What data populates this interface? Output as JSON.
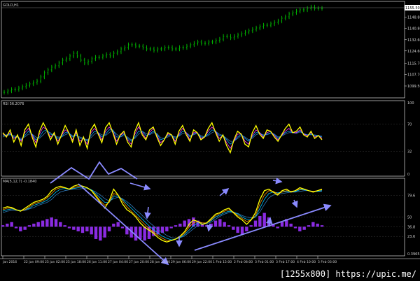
{
  "chart_data": [
    {
      "type": "ohlc",
      "symbol_label": "GOLD,H1",
      "price_axis": {
        "ylim": [
          1093,
          1158
        ],
        "ticks": [
          1148.8,
          1140.8,
          1132.6,
          1124.6,
          1115.7,
          1107.7,
          1099.5
        ],
        "current_price": 1155.5,
        "current_price_label": "1155.50"
      },
      "close_series": [
        1095,
        1096,
        1097,
        1097,
        1098,
        1099,
        1100,
        1101,
        1102,
        1103,
        1106,
        1109,
        1111,
        1113,
        1114,
        1116,
        1118,
        1119,
        1121,
        1123,
        1121,
        1118,
        1116,
        1117,
        1119,
        1120,
        1120,
        1121,
        1122,
        1121,
        1123,
        1124,
        1126,
        1127,
        1129,
        1129,
        1128,
        1128,
        1127,
        1126,
        1126,
        1125,
        1126,
        1126,
        1127,
        1127,
        1126,
        1126,
        1127,
        1127,
        1128,
        1129,
        1130,
        1131,
        1130,
        1130,
        1131,
        1131,
        1132,
        1133,
        1135,
        1135,
        1134,
        1135,
        1136,
        1137,
        1138,
        1139,
        1140,
        1141,
        1142,
        1143,
        1143,
        1144,
        1145,
        1146,
        1148,
        1149,
        1151,
        1152,
        1153,
        1154,
        1154,
        1155,
        1156,
        1155,
        1155,
        1155
      ]
    },
    {
      "type": "line",
      "title": "RSI 56.2076",
      "ylim": [
        0,
        100
      ],
      "tick_labels": [
        "100",
        "70",
        "32",
        "0"
      ],
      "tick_values": [
        100,
        70,
        32,
        0
      ],
      "series": [
        {
          "color": "#ffff00",
          "values": [
            58,
            52,
            62,
            45,
            55,
            40,
            62,
            70,
            52,
            38,
            60,
            72,
            62,
            48,
            58,
            42,
            55,
            68,
            58,
            45,
            62,
            40,
            52,
            36,
            62,
            70,
            56,
            44,
            65,
            72,
            58,
            42,
            55,
            60,
            45,
            38,
            60,
            72,
            55,
            48,
            62,
            66,
            52,
            40,
            48,
            58,
            55,
            42,
            60,
            68,
            55,
            46,
            62,
            58,
            48,
            52,
            64,
            72,
            58,
            46,
            55,
            40,
            30,
            48,
            60,
            56,
            42,
            38,
            58,
            68,
            56,
            50,
            62,
            60,
            52,
            46,
            55,
            64,
            70,
            58,
            60,
            66,
            55,
            52,
            60,
            50,
            54,
            48
          ]
        },
        {
          "color": "#ff33ff",
          "values": [
            56,
            54,
            58,
            50,
            53,
            46,
            58,
            64,
            55,
            44,
            56,
            66,
            62,
            52,
            56,
            46,
            54,
            62,
            58,
            48,
            58,
            46,
            50,
            42,
            58,
            64,
            58,
            48,
            60,
            66,
            60,
            46,
            54,
            58,
            48,
            42,
            56,
            66,
            58,
            50,
            58,
            64,
            54,
            44,
            48,
            56,
            55,
            46,
            56,
            64,
            58,
            48,
            58,
            58,
            50,
            52,
            60,
            66,
            60,
            50,
            54,
            44,
            36,
            46,
            56,
            56,
            46,
            42,
            54,
            62,
            58,
            52,
            58,
            60,
            54,
            48,
            54,
            60,
            64,
            58,
            58,
            62,
            56,
            54,
            58,
            52,
            54,
            50
          ]
        },
        {
          "color": "#00a0ff",
          "values": [
            54,
            55,
            56,
            52,
            52,
            48,
            54,
            60,
            56,
            48,
            52,
            60,
            62,
            56,
            54,
            50,
            52,
            58,
            58,
            52,
            55,
            50,
            50,
            46,
            54,
            60,
            58,
            52,
            56,
            62,
            62,
            52,
            52,
            56,
            50,
            46,
            52,
            60,
            60,
            54,
            56,
            60,
            56,
            48,
            50,
            54,
            55,
            50,
            54,
            60,
            58,
            52,
            56,
            58,
            52,
            52,
            56,
            62,
            60,
            54,
            54,
            48,
            42,
            46,
            52,
            56,
            50,
            46,
            52,
            58,
            58,
            54,
            56,
            58,
            56,
            50,
            54,
            58,
            60,
            58,
            58,
            60,
            56,
            55,
            56,
            54,
            54,
            52
          ]
        },
        {
          "color": "#3a6fa0",
          "values": [
            52,
            54,
            55,
            54,
            52,
            50,
            52,
            56,
            56,
            52,
            50,
            55,
            60,
            58,
            54,
            52,
            52,
            55,
            57,
            54,
            54,
            52,
            50,
            48,
            51,
            56,
            58,
            55,
            54,
            58,
            61,
            56,
            52,
            54,
            52,
            48,
            50,
            56,
            60,
            57,
            55,
            58,
            57,
            51,
            50,
            52,
            54,
            52,
            53,
            57,
            58,
            54,
            55,
            57,
            54,
            52,
            54,
            58,
            60,
            56,
            54,
            50,
            46,
            46,
            50,
            54,
            52,
            48,
            50,
            55,
            57,
            55,
            55,
            57,
            56,
            52,
            53,
            56,
            58,
            58,
            57,
            59,
            57,
            55,
            55,
            55,
            54,
            53
          ]
        }
      ]
    },
    {
      "type": "line+bar",
      "title": "MA(5,12,7) -0.1840",
      "ylim": [
        0,
        100
      ],
      "tick_labels": [
        "79.6",
        "50",
        "36.8",
        "23.6",
        "0.3965"
      ],
      "tick_values": [
        79.6,
        50,
        36.8,
        23.6,
        0
      ],
      "lines": [
        {
          "color": "#ffff00",
          "values": [
            62,
            64,
            63,
            60,
            58,
            62,
            66,
            70,
            72,
            74,
            78,
            86,
            90,
            92,
            90,
            88,
            92,
            94,
            92,
            90,
            86,
            78,
            70,
            62,
            72,
            88,
            80,
            68,
            60,
            56,
            50,
            42,
            36,
            32,
            28,
            22,
            18,
            16,
            18,
            20,
            24,
            30,
            40,
            46,
            44,
            40,
            42,
            48,
            54,
            56,
            60,
            62,
            56,
            50,
            46,
            40,
            46,
            56,
            74,
            86,
            88,
            84,
            80,
            86,
            88,
            84,
            86,
            90,
            88,
            86,
            84,
            86,
            88
          ]
        },
        {
          "color": "#ff9900",
          "values": [
            60,
            62,
            62,
            60,
            58,
            60,
            64,
            68,
            70,
            72,
            76,
            82,
            88,
            90,
            90,
            88,
            90,
            92,
            92,
            90,
            86,
            80,
            72,
            66,
            70,
            82,
            80,
            72,
            64,
            58,
            52,
            46,
            40,
            34,
            30,
            25,
            21,
            18,
            18,
            20,
            23,
            28,
            36,
            42,
            44,
            42,
            42,
            46,
            52,
            55,
            58,
            60,
            57,
            52,
            48,
            44,
            46,
            52,
            68,
            80,
            86,
            85,
            82,
            84,
            86,
            85,
            86,
            88,
            88,
            86,
            85,
            86,
            87
          ]
        },
        {
          "color": "#00c8ff",
          "values": [
            58,
            60,
            61,
            60,
            59,
            60,
            62,
            66,
            68,
            70,
            73,
            78,
            84,
            88,
            89,
            88,
            89,
            90,
            91,
            90,
            87,
            82,
            76,
            70,
            70,
            78,
            79,
            74,
            68,
            62,
            56,
            50,
            44,
            38,
            33,
            28,
            24,
            21,
            19,
            20,
            22,
            26,
            32,
            38,
            42,
            42,
            42,
            45,
            50,
            53,
            56,
            58,
            57,
            54,
            50,
            47,
            47,
            50,
            62,
            74,
            82,
            84,
            83,
            84,
            85,
            85,
            85,
            87,
            87,
            86,
            85,
            85,
            86
          ]
        },
        {
          "color": "#2f78b8",
          "values": [
            56,
            58,
            59,
            59,
            59,
            59,
            61,
            63,
            66,
            68,
            70,
            74,
            80,
            84,
            86,
            87,
            88,
            88,
            89,
            89,
            87,
            84,
            80,
            75,
            72,
            75,
            77,
            75,
            71,
            66,
            60,
            55,
            49,
            43,
            38,
            33,
            29,
            25,
            22,
            21,
            22,
            24,
            29,
            34,
            38,
            40,
            41,
            43,
            47,
            51,
            54,
            56,
            56,
            55,
            52,
            50,
            49,
            50,
            57,
            67,
            76,
            80,
            81,
            82,
            83,
            84,
            84,
            85,
            86,
            86,
            85,
            85,
            85
          ]
        }
      ],
      "histogram": [
        0.1,
        0.2,
        0.3,
        -0.1,
        -0.3,
        -0.2,
        0.1,
        0.2,
        0.3,
        0.4,
        0.5,
        0.6,
        0.5,
        0.3,
        0.1,
        -0.1,
        -0.2,
        -0.3,
        -0.4,
        -0.3,
        -0.5,
        -0.8,
        -0.9,
        -0.7,
        -0.3,
        0.2,
        0.3,
        -0.1,
        -0.5,
        -0.7,
        -0.9,
        -0.8,
        -0.9,
        -0.8,
        -0.6,
        -0.5,
        -0.4,
        -0.3,
        -0.1,
        0.1,
        0.2,
        0.4,
        0.5,
        0.6,
        0.4,
        0.2,
        0.1,
        0.2,
        0.4,
        0.5,
        0.3,
        0.1,
        -0.2,
        -0.4,
        -0.5,
        -0.3,
        0.1,
        0.4,
        0.7,
        0.9,
        0.6,
        0.2,
        -0.1,
        0.3,
        0.5,
        0.2,
        -0.1,
        -0.3,
        -0.2,
        0.1,
        0.3,
        0.2,
        0.1
      ]
    }
  ],
  "time_axis": {
    "labels": [
      "Jan 2016",
      "22 Jan 09:00",
      "25 Jan 02:00",
      "25 Jan 18:00",
      "26 Jan 11:00",
      "27 Jan 04:00",
      "27 Jan 20:00",
      "28 Jan 13:00",
      "29 Jan 06:00",
      "29 Jan 22:00",
      "1 Feb 15:00",
      "2 Feb 08:00",
      "3 Feb 01:00",
      "3 Feb 17:00",
      "4 Feb 10:00",
      "5 Feb 03:00"
    ]
  },
  "colors": {
    "background": "#000000",
    "grid": "#3a3a3a",
    "candles": "#00c000",
    "annotation": "#8a8aff",
    "histogram": "#8a2be2"
  },
  "watermark": "[1255x800] https://upic.me/"
}
